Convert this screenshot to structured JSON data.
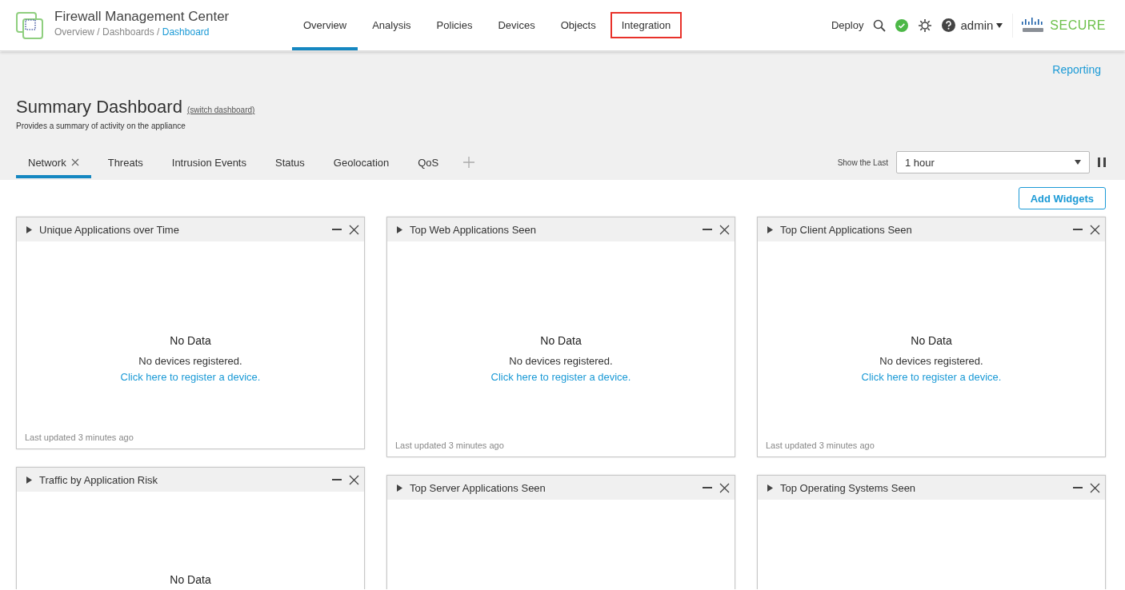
{
  "app": {
    "title": "Firewall Management Center",
    "breadcrumb": [
      {
        "label": "Overview",
        "current": false
      },
      {
        "label": "Dashboards",
        "current": false
      },
      {
        "label": "Dashboard",
        "current": true
      }
    ],
    "separator": "/"
  },
  "nav": [
    {
      "label": "Overview",
      "selected": true,
      "highlighted": false
    },
    {
      "label": "Analysis",
      "selected": false,
      "highlighted": false
    },
    {
      "label": "Policies",
      "selected": false,
      "highlighted": false
    },
    {
      "label": "Devices",
      "selected": false,
      "highlighted": false
    },
    {
      "label": "Objects",
      "selected": false,
      "highlighted": false
    },
    {
      "label": "Integration",
      "selected": false,
      "highlighted": true
    }
  ],
  "toolbar": {
    "deploy": "Deploy",
    "user": "admin",
    "brand": "SECURE"
  },
  "reporting_link": "Reporting",
  "dashboard": {
    "title": "Summary Dashboard",
    "switch_link": "(switch dashboard)",
    "description": "Provides a summary of activity on the appliance",
    "tabs": [
      {
        "label": "Network",
        "selected": true,
        "closable": true
      },
      {
        "label": "Threats",
        "selected": false,
        "closable": false
      },
      {
        "label": "Intrusion Events",
        "selected": false,
        "closable": false
      },
      {
        "label": "Status",
        "selected": false,
        "closable": false
      },
      {
        "label": "Geolocation",
        "selected": false,
        "closable": false
      },
      {
        "label": "QoS",
        "selected": false,
        "closable": false
      }
    ],
    "time_range": {
      "label": "Show the Last",
      "value": "1 hour"
    },
    "add_widgets": "Add Widgets"
  },
  "widget_columns": [
    [
      {
        "title": "Unique Applications over Time",
        "no_data": "No Data",
        "message": "No devices registered.",
        "link": "Click here to register a device.",
        "updated": "Last updated 3 minutes ago"
      },
      {
        "title": "Traffic by Application Risk",
        "no_data": "No Data"
      }
    ],
    [
      {
        "title": "Top Web Applications Seen",
        "no_data": "No Data",
        "message": "No devices registered.",
        "link": "Click here to register a device.",
        "updated": "Last updated 3 minutes ago"
      },
      {
        "title": "Top Server Applications Seen"
      }
    ],
    [
      {
        "title": "Top Client Applications Seen",
        "no_data": "No Data",
        "message": "No devices registered.",
        "link": "Click here to register a device.",
        "updated": "Last updated 3 minutes ago"
      },
      {
        "title": "Top Operating Systems Seen"
      }
    ]
  ]
}
